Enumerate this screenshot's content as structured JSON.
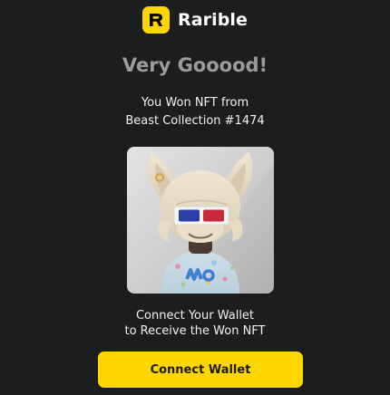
{
  "brand": {
    "logo_letter": "R",
    "name": "Rarible",
    "logo_color": "#fed600"
  },
  "headline": "Very Gooood!",
  "win_message": {
    "line1": "You Won NFT from",
    "line2": "Beast Collection #1474"
  },
  "nft_image": {
    "icon": "nft-beast-character-image"
  },
  "connect_message": {
    "line1": "Connect Your Wallet",
    "line2": "to Receive the Won NFT"
  },
  "connect_button": {
    "label": "Connect Wallet",
    "color": "#fed600"
  },
  "colors": {
    "background": "#1c1d1f",
    "headline": "#9c9c9c",
    "accent": "#fed600"
  }
}
